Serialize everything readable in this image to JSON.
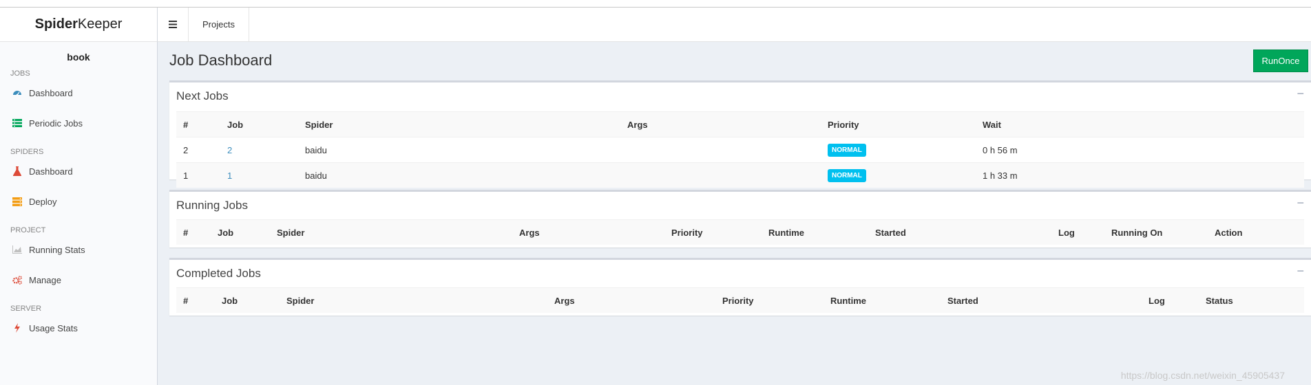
{
  "app": {
    "logo_bold": "Spider",
    "logo_rest": "Keeper"
  },
  "navbar": {
    "toggle_icon": "bars-icon",
    "projects_label": "Projects"
  },
  "sidebar": {
    "project": "book",
    "sections": [
      {
        "header": "JOBS",
        "items": [
          {
            "label": "Dashboard",
            "icon": "dashboard-icon",
            "color": "#3c8dbc"
          },
          {
            "label": "Periodic Jobs",
            "icon": "list-icon",
            "color": "#00a65a"
          }
        ]
      },
      {
        "header": "SPIDERS",
        "items": [
          {
            "label": "Dashboard",
            "icon": "flask-icon",
            "color": "#dd4b39"
          },
          {
            "label": "Deploy",
            "icon": "server-icon",
            "color": "#f39c12"
          }
        ]
      },
      {
        "header": "PROJECT",
        "items": [
          {
            "label": "Running Stats",
            "icon": "area-chart-icon",
            "color": "#c0c0c0"
          },
          {
            "label": "Manage",
            "icon": "cogs-icon",
            "color": "#dd4b39"
          }
        ]
      },
      {
        "header": "SERVER",
        "items": [
          {
            "label": "Usage Stats",
            "icon": "bolt-icon",
            "color": "#dd4b39"
          }
        ]
      }
    ]
  },
  "main": {
    "title": "Job Dashboard",
    "run_once": "RunOnce",
    "collapse_symbol": "−",
    "next_jobs": {
      "title": "Next Jobs",
      "headers": [
        "#",
        "Job",
        "Spider",
        "Args",
        "Priority",
        "Wait"
      ],
      "rows": [
        {
          "num": "2",
          "job": "2",
          "spider": "baidu",
          "args": "",
          "priority": "NORMAL",
          "wait": "0 h 56 m"
        },
        {
          "num": "1",
          "job": "1",
          "spider": "baidu",
          "args": "",
          "priority": "NORMAL",
          "wait": "1 h 33 m"
        }
      ]
    },
    "running_jobs": {
      "title": "Running Jobs",
      "headers": [
        "#",
        "Job",
        "Spider",
        "Args",
        "Priority",
        "Runtime",
        "Started",
        "Log",
        "Running On",
        "Action"
      ]
    },
    "completed_jobs": {
      "title": "Completed Jobs",
      "headers": [
        "#",
        "Job",
        "Spider",
        "Args",
        "Priority",
        "Runtime",
        "Started",
        "Log",
        "Status"
      ]
    }
  },
  "watermark": "https://blog.csdn.net/weixin_45905437",
  "colors": {
    "accent_green": "#00a65a",
    "badge_blue": "#00c0ef",
    "link_blue": "#3c8dbc"
  }
}
